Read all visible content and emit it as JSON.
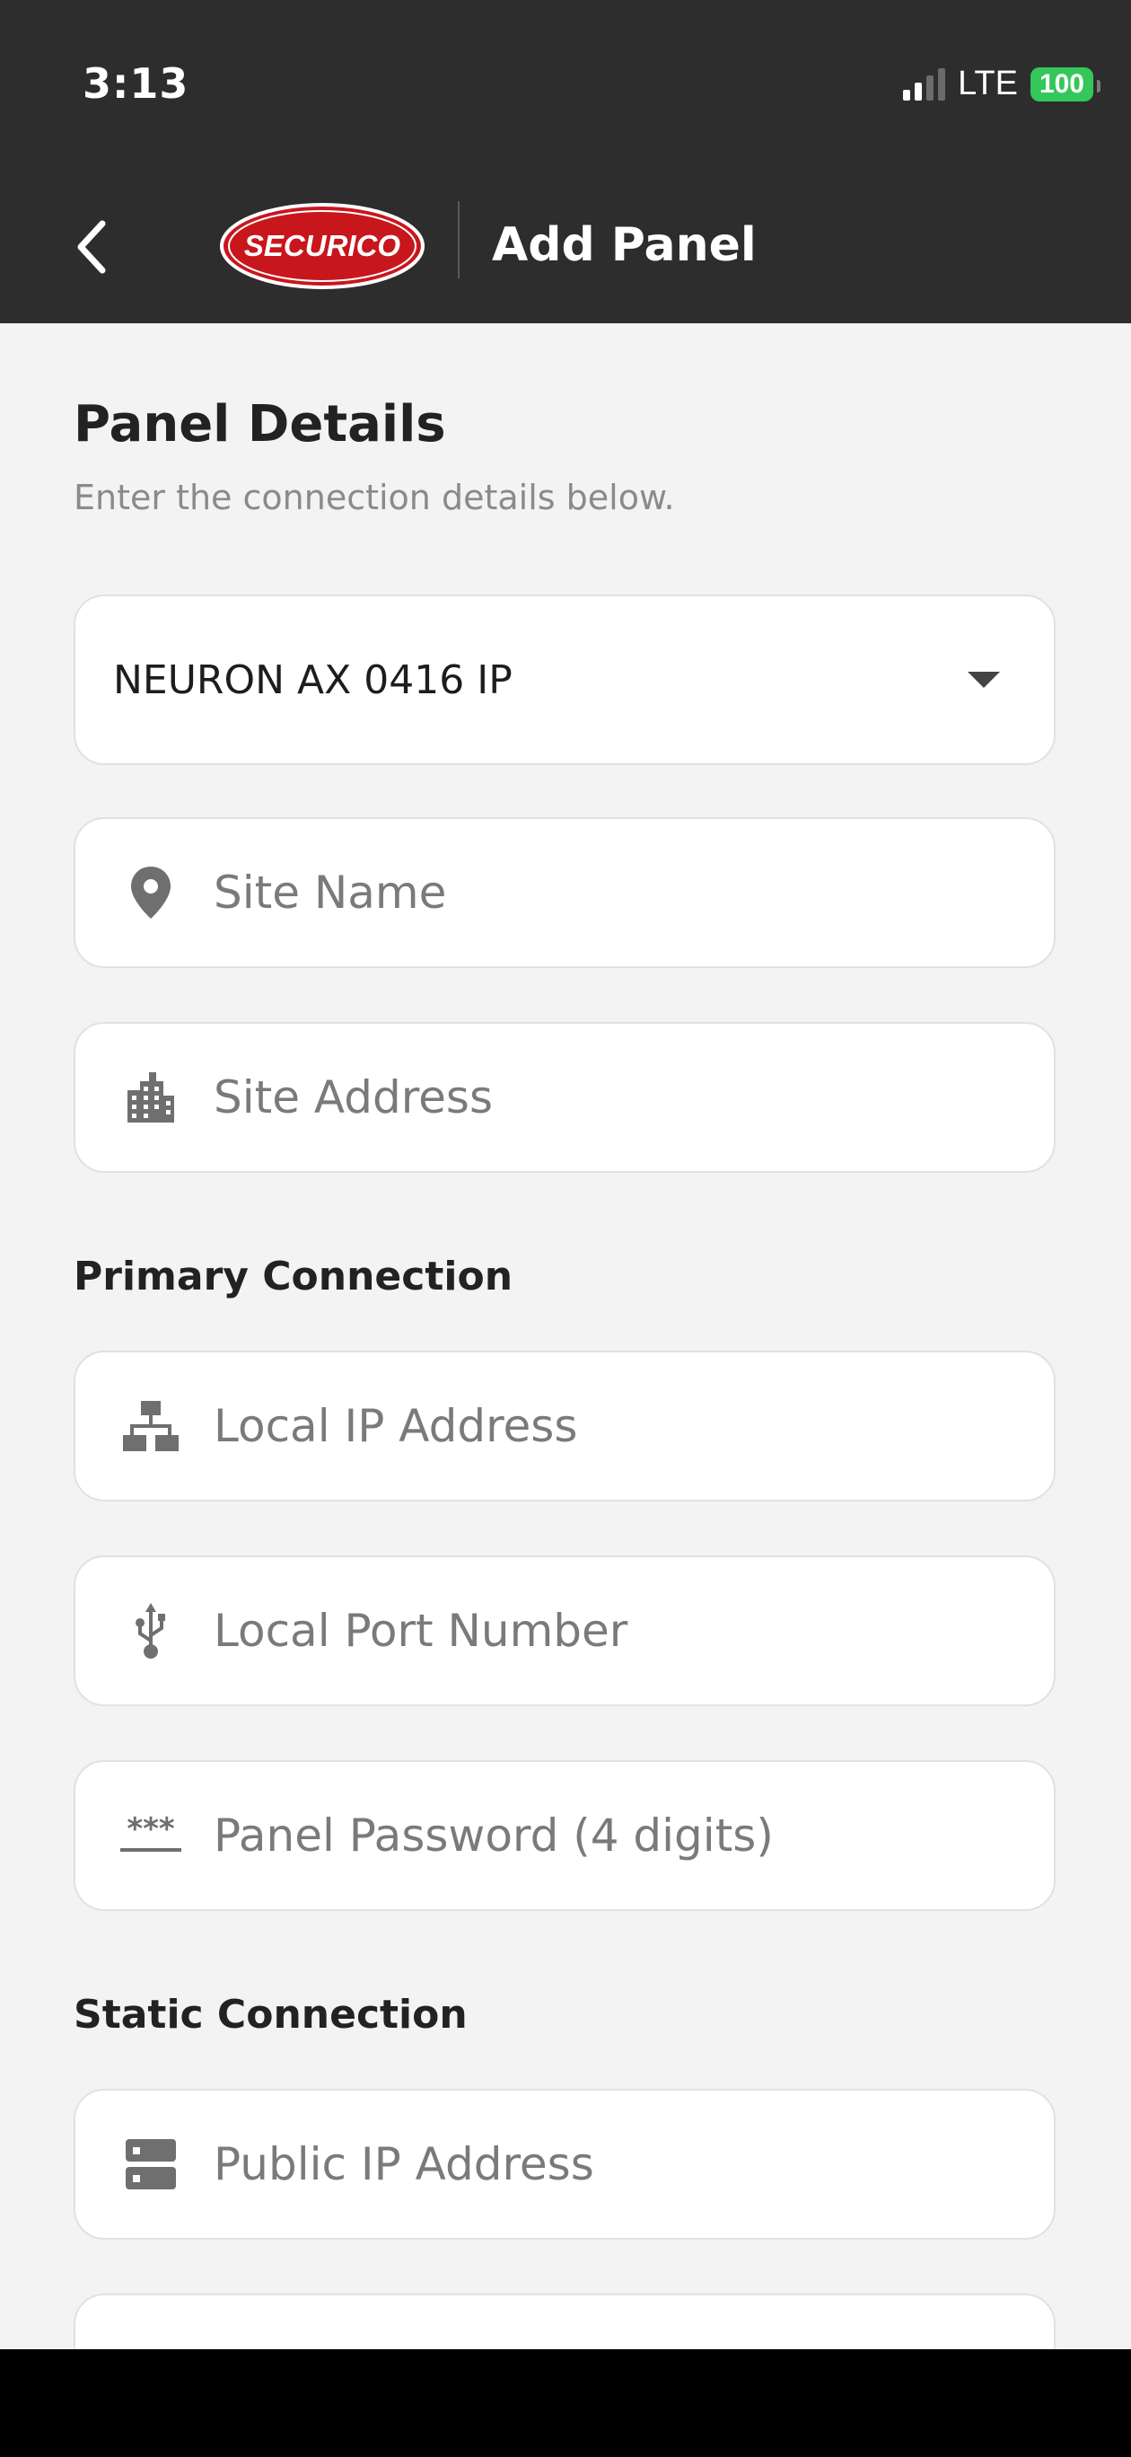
{
  "status_bar": {
    "time": "3:13",
    "network": "LTE",
    "battery": "100"
  },
  "nav": {
    "logo_text": "SECURICO",
    "title": "Add Panel"
  },
  "panel_details": {
    "heading": "Panel Details",
    "subtext": "Enter the connection details below.",
    "panel_type": "NEURON AX 0416 IP",
    "site_name_placeholder": "Site Name",
    "site_address_placeholder": "Site Address"
  },
  "primary_connection": {
    "heading": "Primary Connection",
    "local_ip_placeholder": "Local IP Address",
    "local_port_placeholder": "Local Port Number",
    "password_placeholder": "Panel Password (4 digits)"
  },
  "static_connection": {
    "heading": "Static Connection",
    "public_ip_placeholder": "Public IP Address"
  },
  "icons": {
    "back": "chevron-left-icon",
    "site_name": "map-pin-icon",
    "site_address": "building-icon",
    "local_ip": "network-icon",
    "local_port": "usb-icon",
    "password": "password-icon",
    "public_ip": "server-icon"
  },
  "colors": {
    "header_bg": "#2d2d2d",
    "content_bg": "#f3f3f3",
    "logo_red": "#c8161d",
    "battery_green": "#34c759"
  }
}
